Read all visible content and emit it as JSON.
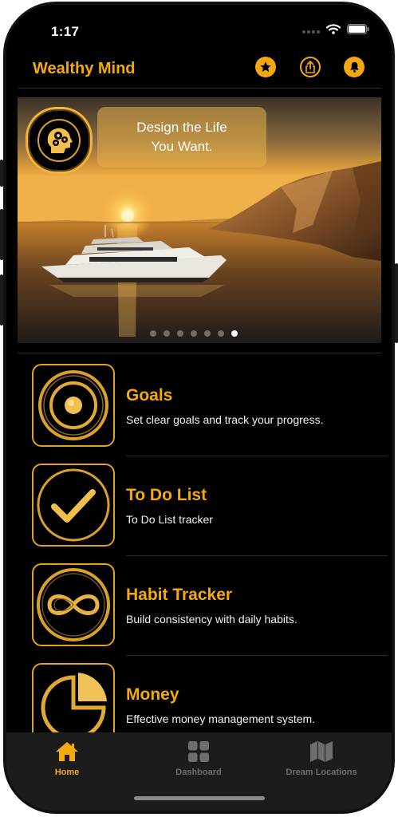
{
  "status_bar": {
    "time": "1:17"
  },
  "header": {
    "title": "Wealthy Mind"
  },
  "hero": {
    "quote_line1": "Design the Life",
    "quote_line2": "You Want.",
    "page_count": 7,
    "active_page": 7
  },
  "features": [
    {
      "title": "Goals",
      "subtitle": "Set clear goals and track your progress.",
      "icon": "target-icon"
    },
    {
      "title": "To Do List",
      "subtitle": "To Do List tracker",
      "icon": "checkmark-icon"
    },
    {
      "title": "Habit Tracker",
      "subtitle": "Build consistency with daily habits.",
      "icon": "infinity-icon"
    },
    {
      "title": "Money",
      "subtitle": "Effective money management system.",
      "icon": "pie-chart-icon"
    }
  ],
  "tabbar": {
    "items": [
      {
        "label": "Home",
        "icon": "house-icon",
        "active": true
      },
      {
        "label": "Dashboard",
        "icon": "grid-icon",
        "active": false
      },
      {
        "label": "Dream Locations",
        "icon": "map-icon",
        "active": false
      }
    ]
  },
  "colors": {
    "accent": "#f5a90b",
    "background": "#000000",
    "tabbar": "#1c1c1c",
    "inactive": "#6e6e6e"
  }
}
